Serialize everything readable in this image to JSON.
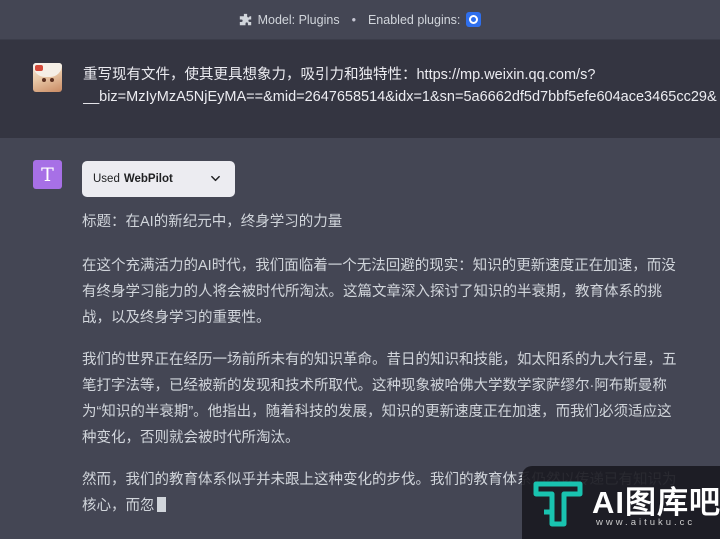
{
  "topbar": {
    "model_label": "Model: Plugins",
    "separator": "•",
    "plugins_label": "Enabled plugins:"
  },
  "user_message": {
    "line1": "重写现有文件，使其更具想象力，吸引力和独特性：https://mp.weixin.qq.com/s?",
    "line2": "__biz=MzIyMzA5NjEyMA==&mid=2647658514&idx=1&sn=5a6662df5d7bbf5efe604ace3465cc29&"
  },
  "assistant": {
    "avatar_letter": "T",
    "plugin_used_prefix": "Used",
    "plugin_used_name": "WebPilot",
    "title": "标题：在AI的新纪元中，终身学习的力量",
    "para1": "在这个充满活力的AI时代，我们面临着一个无法回避的现实：知识的更新速度正在加速，而没有终身学习能力的人将会被时代所淘汰。这篇文章深入探讨了知识的半衰期，教育体系的挑战，以及终身学习的重要性。",
    "para2": "我们的世界正在经历一场前所未有的知识革命。昔日的知识和技能，如太阳系的九大行星，五笔打字法等，已经被新的发现和技术所取代。这种现象被哈佛大学数学家萨缪尔·阿布斯曼称为“知识的半衰期”。他指出，随着科技的发展，知识的更新速度正在加速，而我们必须适应这种变化，否则就会被时代所淘汰。",
    "para3": "然而，我们的教育体系似乎并未跟上这种变化的步伐。我们的教育体系仍然以传递已有知识为核心，而忽"
  },
  "watermark": {
    "text": "AI图库吧",
    "url": "www.aituku.cc"
  },
  "colors": {
    "background": "#444654",
    "user_row": "#343541",
    "assistant_avatar": "#a770e6",
    "plugin_badge": "#2f6fed"
  }
}
